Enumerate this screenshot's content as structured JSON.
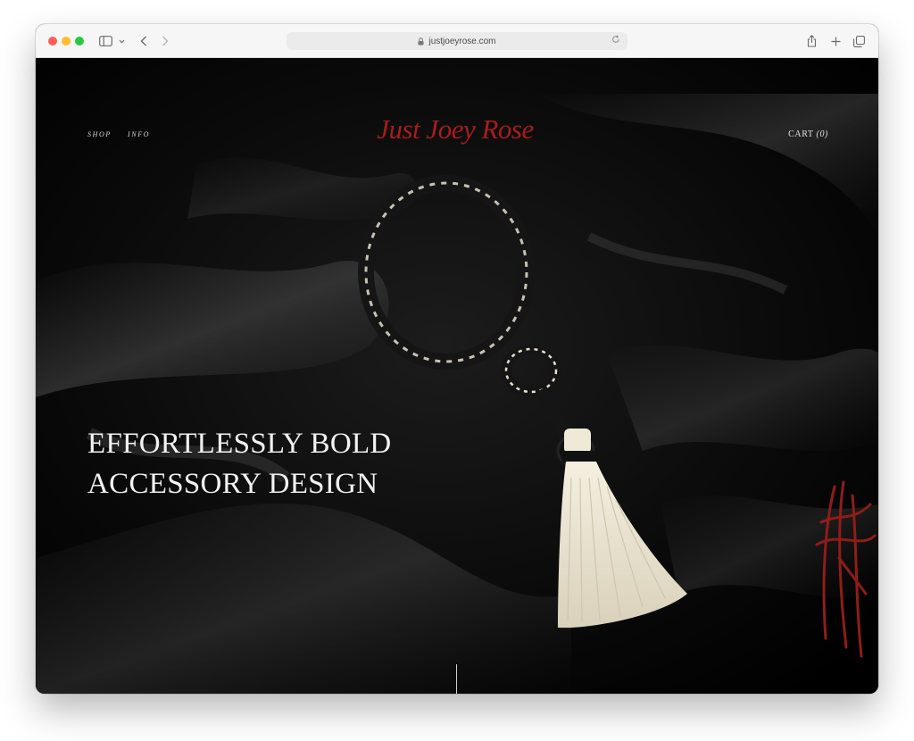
{
  "browser": {
    "url": "justjoeyrose.com"
  },
  "nav": {
    "shop": "SHOP",
    "info": "INFO",
    "cart_label": "CART",
    "cart_count": "(0)"
  },
  "brand": {
    "logo_text": "Just Joey Rose",
    "accent_color": "#a81c1c"
  },
  "hero": {
    "headline_line1": "EFFORTLESSLY BOLD",
    "headline_line2": "ACCESSORY DESIGN"
  },
  "icons": [
    "sidebar-icon",
    "chevron-down-icon",
    "back-icon",
    "forward-icon",
    "lock-icon",
    "reload-icon",
    "share-icon",
    "new-tab-icon",
    "tabs-overview-icon",
    "monogram-logo"
  ]
}
